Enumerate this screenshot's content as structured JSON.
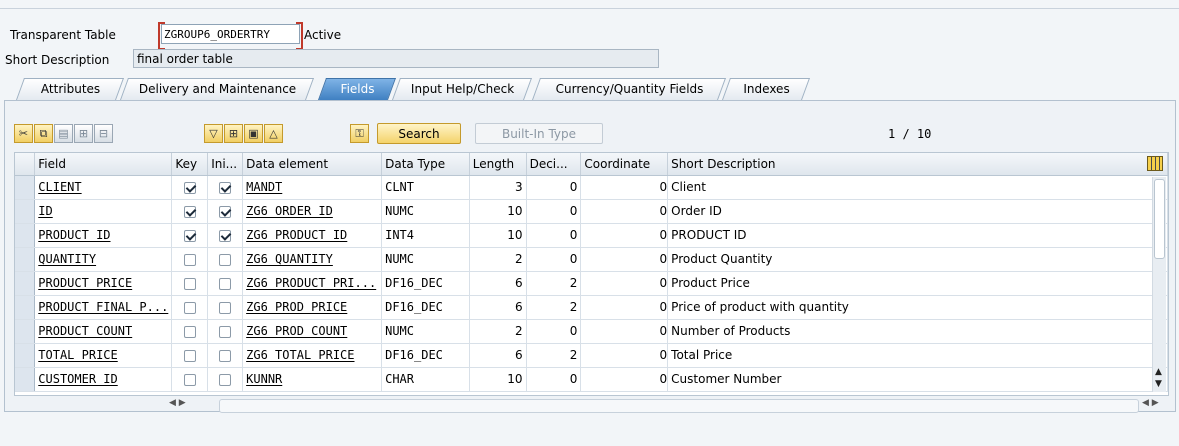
{
  "header": {
    "table_label": "Transparent Table",
    "table_name": "ZGROUP6_ORDERTRY",
    "status": "Active",
    "short_desc_label": "Short Description",
    "short_desc_value": "final order table"
  },
  "tabs": [
    {
      "label": "Attributes",
      "active": false
    },
    {
      "label": "Delivery and Maintenance",
      "active": false
    },
    {
      "label": "Fields",
      "active": true
    },
    {
      "label": "Input Help/Check",
      "active": false
    },
    {
      "label": "Currency/Quantity Fields",
      "active": false
    },
    {
      "label": "Indexes",
      "active": false
    }
  ],
  "toolbar": {
    "search_label": "Search",
    "builtin_label": "Built-In Type",
    "counter": "1 / 10",
    "icons": [
      "cut-icon",
      "copy-icon",
      "paste-icon",
      "insert-row-icon",
      "delete-row-icon",
      "filter-icon",
      "insert-field-icon",
      "append-field-icon",
      "move-up-icon",
      "key-search-icon"
    ]
  },
  "grid": {
    "headers": [
      "Field",
      "Key",
      "Ini...",
      "Data element",
      "Data Type",
      "Length",
      "Deci...",
      "Coordinate",
      "Short Description"
    ],
    "rows": [
      {
        "field": "CLIENT",
        "key": true,
        "init": true,
        "data_element": "MANDT",
        "data_type": "CLNT",
        "length": "3",
        "decimals": "0",
        "coordinate": "0",
        "short_desc": "Client"
      },
      {
        "field": "ID",
        "key": true,
        "init": true,
        "data_element": "ZG6_ORDER_ID",
        "data_type": "NUMC",
        "length": "10",
        "decimals": "0",
        "coordinate": "0",
        "short_desc": "Order ID"
      },
      {
        "field": "PRODUCT_ID",
        "key": true,
        "init": true,
        "data_element": "ZG6_PRODUCT_ID",
        "data_type": "INT4",
        "length": "10",
        "decimals": "0",
        "coordinate": "0",
        "short_desc": "PRODUCT ID"
      },
      {
        "field": "QUANTITY",
        "key": false,
        "init": false,
        "data_element": "ZG6_QUANTITY",
        "data_type": "NUMC",
        "length": "2",
        "decimals": "0",
        "coordinate": "0",
        "short_desc": "Product Quantity"
      },
      {
        "field": "PRODUCT_PRICE",
        "key": false,
        "init": false,
        "data_element": "ZG6_PRODUCT_PRI...",
        "data_type": "DF16_DEC",
        "length": "6",
        "decimals": "2",
        "coordinate": "0",
        "short_desc": "Product Price"
      },
      {
        "field": "PRODUCT_FINAL_P...",
        "key": false,
        "init": false,
        "data_element": "ZG6_PROD_PRICE",
        "data_type": "DF16_DEC",
        "length": "6",
        "decimals": "2",
        "coordinate": "0",
        "short_desc": "Price of product with quantity"
      },
      {
        "field": "PRODUCT_COUNT",
        "key": false,
        "init": false,
        "data_element": "ZG6_PROD_COUNT",
        "data_type": "NUMC",
        "length": "2",
        "decimals": "0",
        "coordinate": "0",
        "short_desc": "Number of Products"
      },
      {
        "field": "TOTAL_PRICE",
        "key": false,
        "init": false,
        "data_element": "ZG6_TOTAL_PRICE",
        "data_type": "DF16_DEC",
        "length": "6",
        "decimals": "2",
        "coordinate": "0",
        "short_desc": "Total Price"
      },
      {
        "field": "CUSTOMER_ID",
        "key": false,
        "init": false,
        "data_element": "KUNNR",
        "data_type": "CHAR",
        "length": "10",
        "decimals": "0",
        "coordinate": "0",
        "short_desc": "Customer Number"
      }
    ]
  }
}
